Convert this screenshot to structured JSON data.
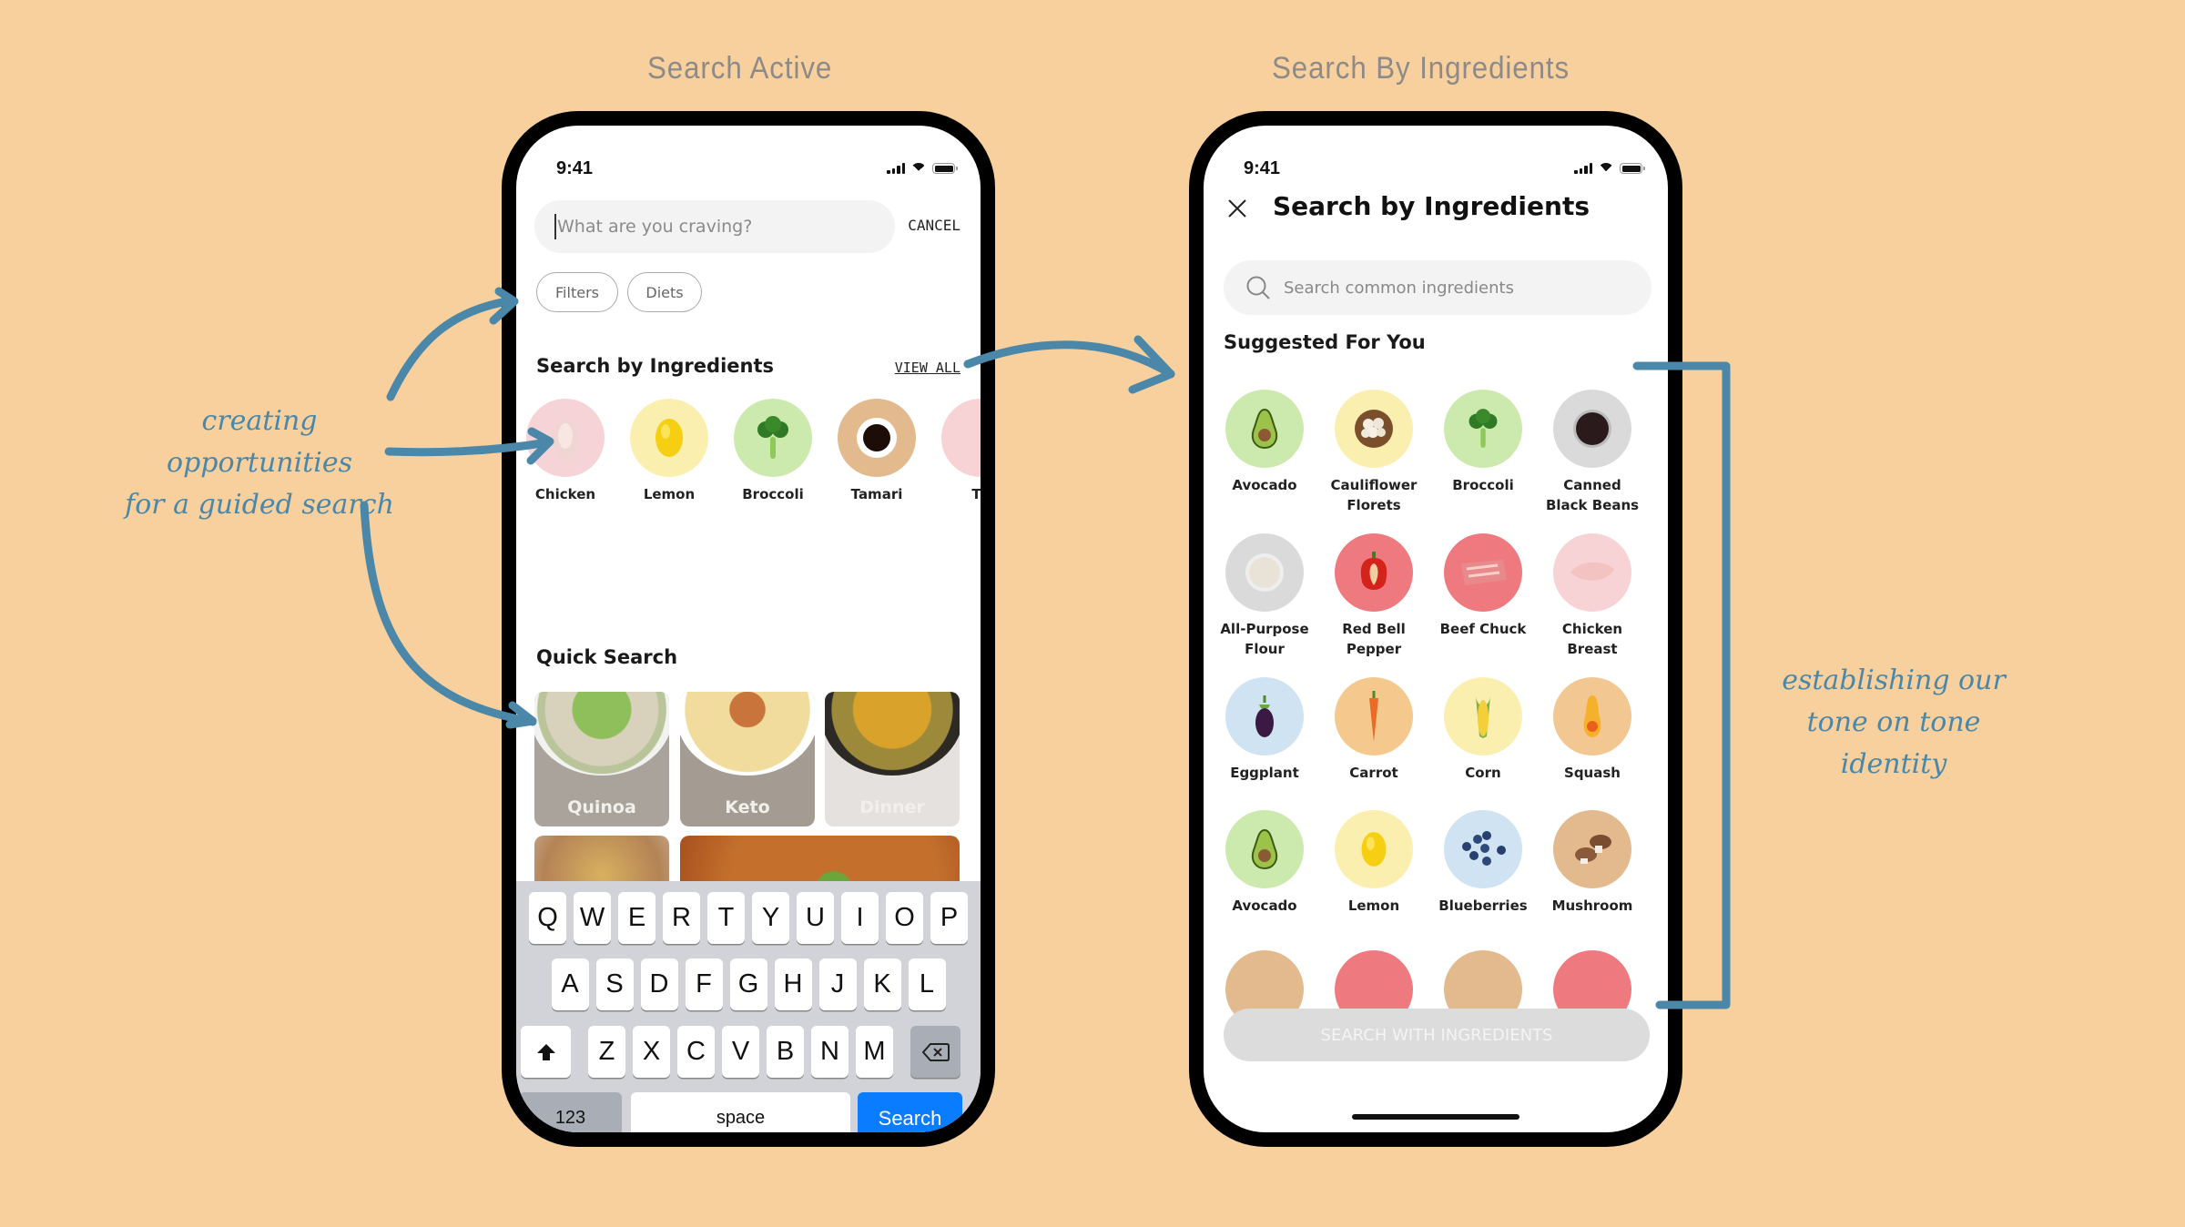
{
  "captions": {
    "left": "Search Active",
    "right": "Search By Ingredients"
  },
  "annotations": {
    "left": [
      "creating opportunities",
      "for a guided search"
    ],
    "right": [
      "establishing our",
      "tone on tone identity"
    ],
    "accent_color": "#4a87a8"
  },
  "screen_active": {
    "status": {
      "time": "9:41"
    },
    "search": {
      "placeholder": "What are you craving?",
      "value": "",
      "cancel_label": "CANCEL"
    },
    "chips": [
      "Filters",
      "Diets"
    ],
    "ingredients_section": {
      "title": "Search by Ingredients",
      "view_all_label": "VIEW ALL",
      "items": [
        {
          "label": "Chicken",
          "icon": "chicken-icon",
          "color": "#f5d3d6"
        },
        {
          "label": "Lemon",
          "icon": "lemon-icon",
          "color": "#fbefb0"
        },
        {
          "label": "Broccoli",
          "icon": "broccoli-icon",
          "color": "#cdeaae"
        },
        {
          "label": "Tamari",
          "icon": "tamari-icon",
          "color": "#e3b98e"
        },
        {
          "label": "Tu",
          "icon": "tuna-icon",
          "color": "#f7d3d6"
        }
      ]
    },
    "quick_search": {
      "title": "Quick Search",
      "tiles": [
        {
          "label": "Quinoa",
          "color": "#a9a39b"
        },
        {
          "label": "Keto",
          "color": "#a49c93"
        },
        {
          "label": "Dinner",
          "color": "#e4e1de"
        },
        {
          "label": "",
          "color": "#d8d2c8"
        },
        {
          "label": "",
          "color": "#c4702c"
        }
      ]
    },
    "keyboard": {
      "row1": [
        "Q",
        "W",
        "E",
        "R",
        "T",
        "Y",
        "U",
        "I",
        "O",
        "P"
      ],
      "row2": [
        "A",
        "S",
        "D",
        "F",
        "G",
        "H",
        "J",
        "K",
        "L"
      ],
      "row3": [
        "Z",
        "X",
        "C",
        "V",
        "B",
        "N",
        "M"
      ],
      "numbers_label": "123",
      "space_label": "space",
      "search_label": "Search"
    }
  },
  "screen_ingredients": {
    "status": {
      "time": "9:41"
    },
    "title": "Search by Ingredients",
    "search": {
      "placeholder": "Search common ingredients",
      "value": ""
    },
    "section_title": "Suggested For You",
    "items": [
      {
        "label": "Avocado",
        "color": "#cdeaae"
      },
      {
        "label": "Cauliflower Florets",
        "color": "#fbefb0"
      },
      {
        "label": "Broccoli",
        "color": "#cdeaae"
      },
      {
        "label": "Canned Black Beans",
        "color": "#dadada"
      },
      {
        "label": "All-Purpose Flour",
        "color": "#dadada"
      },
      {
        "label": "Red Bell Pepper",
        "color": "#ee7a7f"
      },
      {
        "label": "Beef Chuck",
        "color": "#ee7a7f"
      },
      {
        "label": "Chicken Breast",
        "color": "#f7d3d6"
      },
      {
        "label": "Eggplant",
        "color": "#cfe3f2"
      },
      {
        "label": "Carrot",
        "color": "#f5c98d"
      },
      {
        "label": "Corn",
        "color": "#fbefb0"
      },
      {
        "label": "Squash",
        "color": "#f2c792"
      },
      {
        "label": "Avocado",
        "color": "#cdeaae"
      },
      {
        "label": "Lemon",
        "color": "#fbefb0"
      },
      {
        "label": "Blueberries",
        "color": "#cfe3f2"
      },
      {
        "label": "Mushroom",
        "color": "#e3b98e"
      },
      {
        "label": "",
        "color": "#e3b98e"
      },
      {
        "label": "",
        "color": "#ee7a7f"
      },
      {
        "label": "",
        "color": "#e3b98e"
      },
      {
        "label": "",
        "color": "#ee7a7f"
      }
    ],
    "cta_label": "SEARCH WITH INGREDIENTS"
  }
}
